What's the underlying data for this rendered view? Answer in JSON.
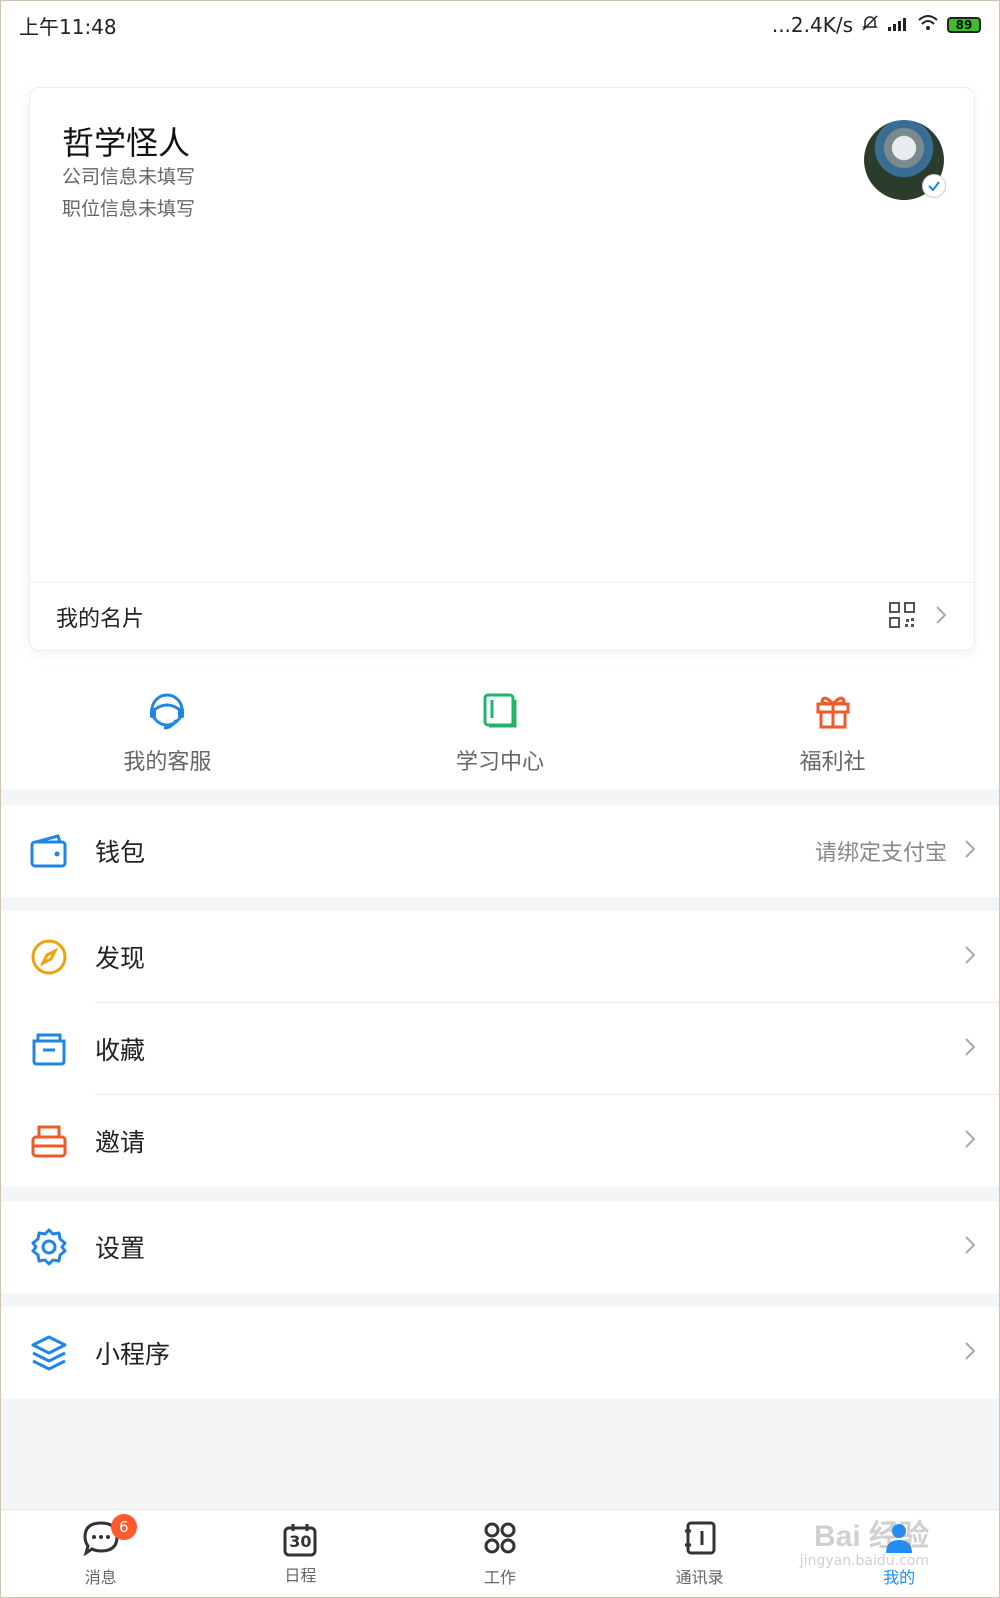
{
  "status_bar": {
    "time": "上午11:48",
    "network_speed": "...2.4K/s",
    "battery_level": "89"
  },
  "profile": {
    "name": "哲学怪人",
    "company": "公司信息未填写",
    "position": "职位信息未填写",
    "card_label": "我的名片"
  },
  "quick_actions": [
    {
      "label": "我的客服",
      "icon": "headset-icon",
      "color": "#1f86e6"
    },
    {
      "label": "学习中心",
      "icon": "book-icon",
      "color": "#23b36b"
    },
    {
      "label": "福利社",
      "icon": "gift-icon",
      "color": "#f05a28"
    }
  ],
  "menu": {
    "wallet": {
      "label": "钱包",
      "trailing": "请绑定支付宝",
      "icon": "wallet-icon",
      "color": "#1f86e6"
    },
    "discover": {
      "label": "发现",
      "icon": "compass-icon",
      "color": "#f0a20c"
    },
    "favorites": {
      "label": "收藏",
      "icon": "folder-icon",
      "color": "#1f86e6"
    },
    "invite": {
      "label": "邀请",
      "icon": "inbox-icon",
      "color": "#f05a28"
    },
    "settings": {
      "label": "设置",
      "icon": "gear-icon",
      "color": "#1f86e6"
    },
    "miniprogram": {
      "label": "小程序",
      "icon": "layers-icon",
      "color": "#1f86e6"
    }
  },
  "tabbar": {
    "items": [
      {
        "label": "消息",
        "icon": "message-icon"
      },
      {
        "label": "日程",
        "icon": "calendar-icon"
      },
      {
        "label": "工作",
        "icon": "apps-icon"
      },
      {
        "label": "通讯录",
        "icon": "contacts-icon"
      },
      {
        "label": "我的",
        "icon": "me-icon"
      }
    ],
    "message_badge": "6",
    "calendar_day": "30",
    "active_color": "#1890ff"
  },
  "watermark": {
    "brand": "Bai 经验",
    "url": "jingyan.baidu.com"
  }
}
